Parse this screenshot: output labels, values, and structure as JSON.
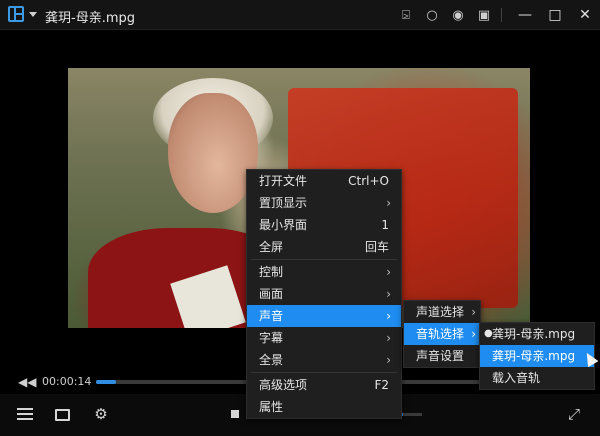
{
  "window": {
    "title": "龚玥-母亲.mpg"
  },
  "title_icons": [
    "pin-icon",
    "bulb-icon",
    "record-icon",
    "picture-icon"
  ],
  "window_controls": [
    "minimize-icon",
    "maximize-icon",
    "close-icon"
  ],
  "playback": {
    "current_time": "00:00:14",
    "progress": 0.04,
    "volume": 0.7
  },
  "context_menu": {
    "items": [
      {
        "label": "打开文件",
        "accel": "Ctrl+O"
      },
      {
        "label": "置顶显示",
        "submenu": true
      },
      {
        "label": "最小界面",
        "accel": "1"
      },
      {
        "label": "全屏",
        "accel": "回车"
      },
      {
        "label": "控制",
        "submenu": true
      },
      {
        "label": "画面",
        "submenu": true
      },
      {
        "label": "声音",
        "submenu": true,
        "active": true
      },
      {
        "label": "字幕",
        "submenu": true
      },
      {
        "label": "全景",
        "submenu": true
      },
      {
        "label": "高级选项",
        "accel": "F2"
      },
      {
        "label": "属性"
      }
    ]
  },
  "sound_submenu": {
    "items": [
      {
        "label": "声道选择",
        "submenu": true
      },
      {
        "label": "音轨选择",
        "submenu": true,
        "active": true
      },
      {
        "label": "声音设置"
      }
    ]
  },
  "track_submenu": {
    "items": [
      {
        "label": "龚玥-母亲.mpg",
        "selected": true
      },
      {
        "label": "龚玥-母亲.mpg",
        "active": true
      },
      {
        "label": "载入音轨"
      }
    ]
  }
}
